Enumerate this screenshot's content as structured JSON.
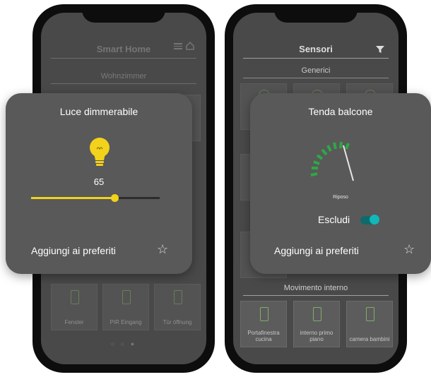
{
  "left_phone": {
    "header_title": "Smart Home",
    "room": "Wohnzimmer",
    "bottom_tiles": [
      {
        "label": "Fenster"
      },
      {
        "label": "PIR Eingang"
      },
      {
        "label": "Tür öffnung"
      }
    ],
    "pagination": "○ ○ ●"
  },
  "right_phone": {
    "header_title": "Sensori",
    "section_generic": "Generici",
    "section_motion": "Movimento interno",
    "motion_tiles": [
      {
        "label": "Portafinestra cucina"
      },
      {
        "label": "interno primo piano"
      },
      {
        "label": "camera bambini"
      }
    ]
  },
  "dimmer_card": {
    "title": "Luce dimmerabile",
    "value": "65",
    "level_percent": 65,
    "add_favorites": "Aggiungi ai preferiti",
    "bulb_color": "#f2d21b"
  },
  "blind_card": {
    "title": "Tenda balcone",
    "state": "Riposo",
    "exclude_label": "Escludi",
    "exclude_on": true,
    "add_favorites": "Aggiungi ai preferiti",
    "gauge_color": "#2fa745"
  },
  "colors": {
    "accent_yellow": "#f2d21b",
    "accent_teal": "#12b7b8",
    "card_bg": "#595959",
    "screen_bg": "#494949"
  }
}
